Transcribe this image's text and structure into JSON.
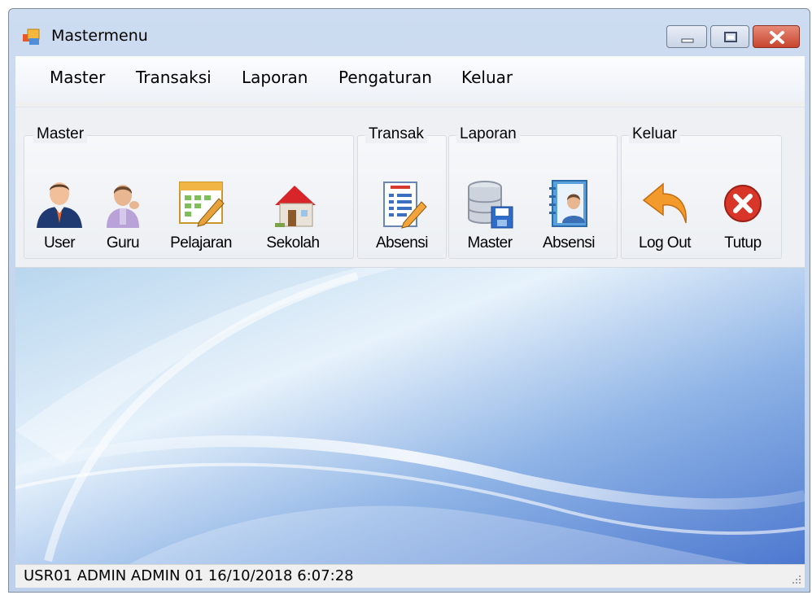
{
  "window": {
    "title": "Mastermenu"
  },
  "menubar": {
    "items": [
      {
        "label": "Master"
      },
      {
        "label": "Transaksi"
      },
      {
        "label": "Laporan"
      },
      {
        "label": "Pengaturan"
      },
      {
        "label": "Keluar"
      }
    ]
  },
  "ribbon": {
    "groups": [
      {
        "title": "Master",
        "buttons": [
          {
            "label": "User",
            "icon": "user-icon"
          },
          {
            "label": "Guru",
            "icon": "teacher-icon"
          },
          {
            "label": "Pelajaran",
            "icon": "schedule-icon"
          },
          {
            "label": "Sekolah",
            "icon": "school-icon"
          }
        ]
      },
      {
        "title": "Transak",
        "buttons": [
          {
            "label": "Absensi",
            "icon": "attendance-document-icon"
          }
        ]
      },
      {
        "title": "Laporan",
        "buttons": [
          {
            "label": "Master",
            "icon": "database-icon"
          },
          {
            "label": "Absensi",
            "icon": "contact-book-icon"
          }
        ]
      },
      {
        "title": "Keluar",
        "buttons": [
          {
            "label": "Log Out",
            "icon": "undo-arrow-icon"
          },
          {
            "label": "Tutup",
            "icon": "close-circle-icon"
          }
        ]
      }
    ]
  },
  "statusbar": {
    "text": "USR01  ADMIN  ADMIN  01  16/10/2018  6:07:28"
  },
  "colors": {
    "accent": "#3a7bd5",
    "close": "#d9362a",
    "undo": "#f39a2c"
  }
}
